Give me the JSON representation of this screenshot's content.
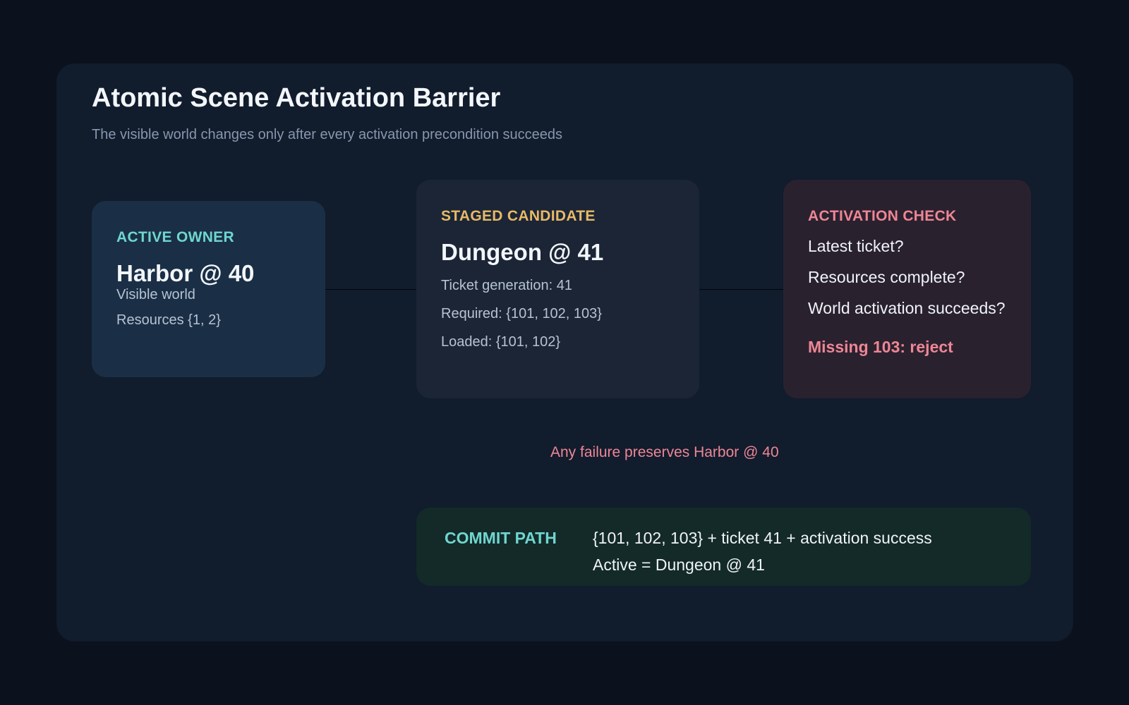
{
  "title": "Atomic Scene Activation Barrier",
  "subtitle": "The visible world changes only after every activation precondition succeeds",
  "active_owner": {
    "label": "ACTIVE OWNER",
    "heading": "Harbor @ 40",
    "lines": [
      "Visible world",
      "Resources {1, 2}"
    ]
  },
  "staged_candidate": {
    "label": "STAGED CANDIDATE",
    "heading": "Dungeon @ 41",
    "lines": [
      "Ticket generation: 41",
      "Required: {101, 102, 103}",
      "Loaded: {101, 102}"
    ]
  },
  "activation_check": {
    "label": "ACTIVATION CHECK",
    "questions": [
      "Latest ticket?",
      "Resources complete?",
      "World activation succeeds?"
    ],
    "verdict": "Missing 103: reject"
  },
  "failure_note": "Any failure preserves Harbor @ 40",
  "commit_path": {
    "label": "COMMIT PATH",
    "lines": [
      "{101, 102, 103} + ticket 41 + activation success",
      "Active = Dungeon @ 41"
    ]
  },
  "colors": {
    "background": "#0b111d",
    "panel": "#111c2d",
    "teal": "#6fd6cf",
    "amber": "#e8b967",
    "rose": "#ee8694"
  }
}
